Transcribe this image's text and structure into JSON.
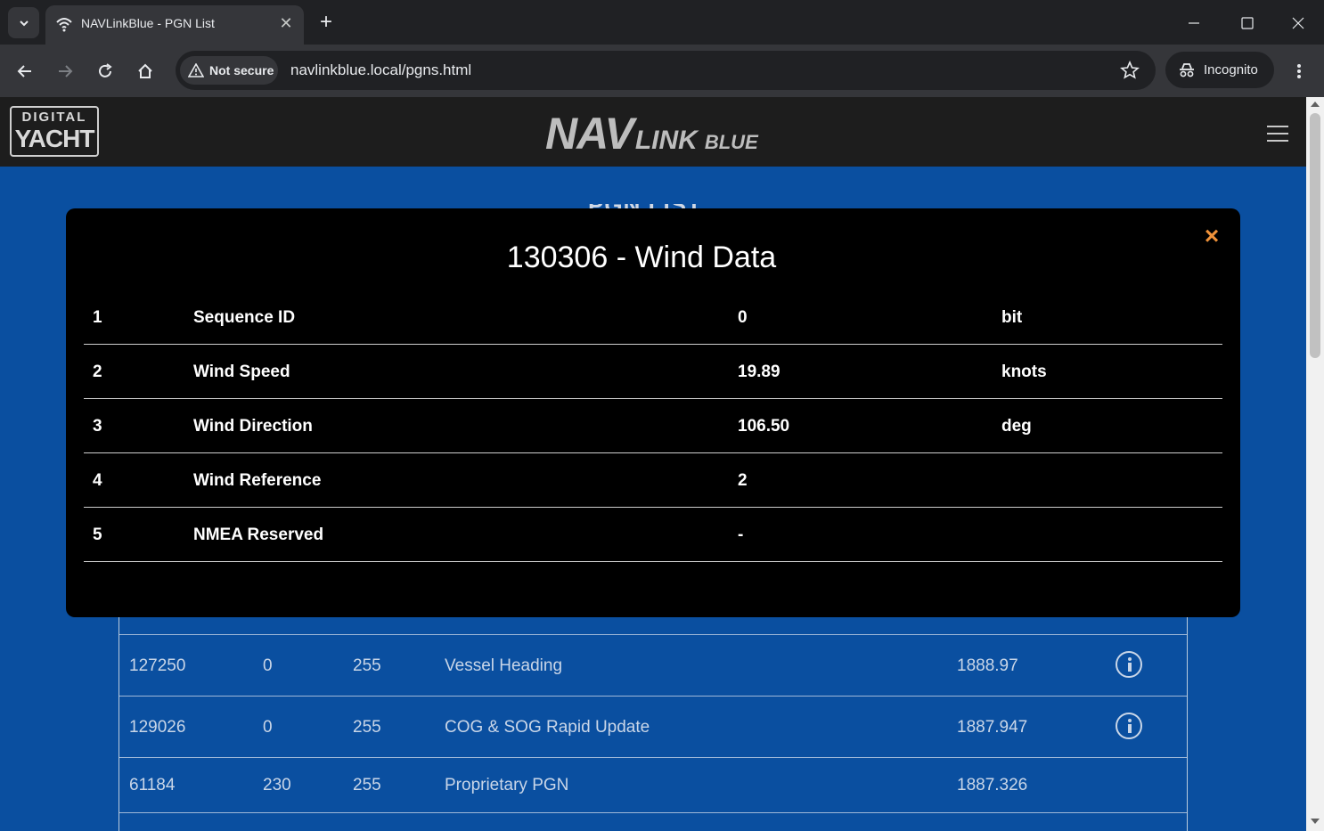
{
  "browser": {
    "tab_title": "NAVLinkBlue - PGN List",
    "security_label": "Not secure",
    "url": "navlinkblue.local/pgns.html",
    "profile_label": "Incognito"
  },
  "site": {
    "brand_logo_top": "DIGITAL",
    "brand_logo_bottom": "YACHT",
    "product_logo": {
      "nav": "NAV",
      "link": "LINK",
      "blue": "BLUE"
    },
    "page_heading": "PGN LIST"
  },
  "modal": {
    "title": "130306 - Wind Data",
    "close_symbol": "×",
    "fields": [
      {
        "num": "1",
        "name": "Sequence ID",
        "value": "0",
        "unit": "bit"
      },
      {
        "num": "2",
        "name": "Wind Speed",
        "value": "19.89",
        "unit": "knots"
      },
      {
        "num": "3",
        "name": "Wind Direction",
        "value": "106.50",
        "unit": "deg"
      },
      {
        "num": "4",
        "name": "Wind Reference",
        "value": "2",
        "unit": ""
      },
      {
        "num": "5",
        "name": "NMEA Reserved",
        "value": "-",
        "unit": ""
      }
    ]
  },
  "pgn_rows": [
    {
      "pgn": "127250",
      "src": "0",
      "dst": "255",
      "name": "Vessel Heading",
      "time": "1888.97",
      "has_info": true
    },
    {
      "pgn": "129026",
      "src": "0",
      "dst": "255",
      "name": "COG & SOG Rapid Update",
      "time": "1887.947",
      "has_info": true
    },
    {
      "pgn": "61184",
      "src": "230",
      "dst": "255",
      "name": "Proprietary PGN",
      "time": "1887.326",
      "has_info": false
    }
  ]
}
